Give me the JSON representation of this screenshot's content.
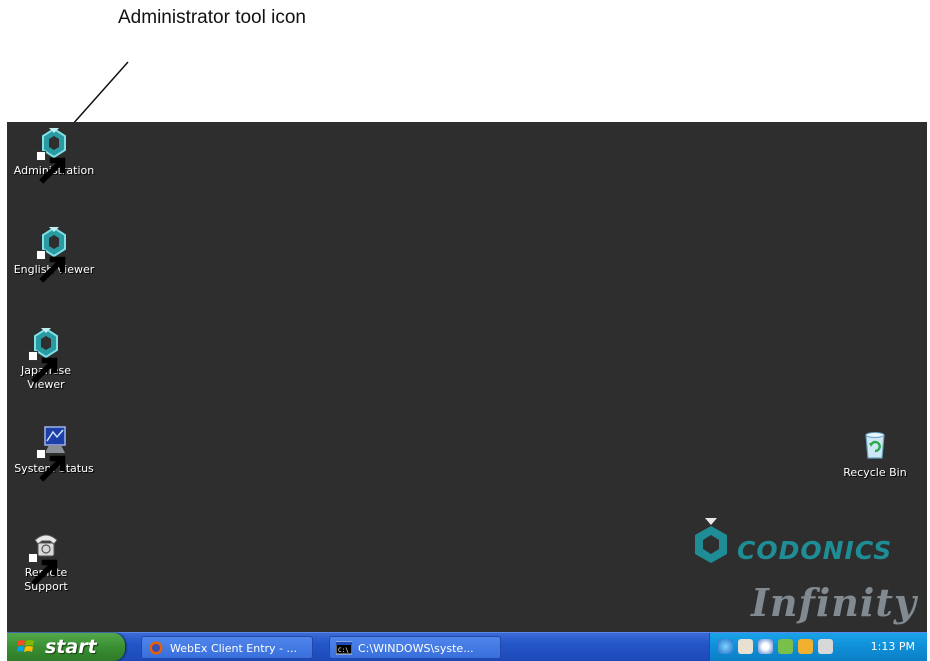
{
  "callout": {
    "text": "Administrator tool icon"
  },
  "desktop_icons": [
    {
      "label": "Administration",
      "icon": "codonics-icon"
    },
    {
      "label": "English Viewer",
      "icon": "codonics-icon"
    },
    {
      "label": "Japanese Viewer",
      "icon": "codonics-icon"
    },
    {
      "label": "System Status",
      "icon": "monitor-icon"
    },
    {
      "label": "Remote Support",
      "icon": "telephone-icon"
    },
    {
      "label": "Recycle Bin",
      "icon": "recycle-bin-icon"
    }
  ],
  "logo": {
    "brand": "CODONICS",
    "product": "Infinity"
  },
  "taskbar": {
    "start_label": "start",
    "tasks": [
      {
        "label": "WebEx Client Entry - ...",
        "icon": "firefox-icon"
      },
      {
        "label": "C:\\WINDOWS\\syste...",
        "icon": "command-prompt-icon"
      }
    ],
    "clock": "1:13 PM"
  },
  "colors": {
    "desktop": "#2e2e2e",
    "accent": "#1f8d95",
    "taskbar": "#2455c8",
    "start": "#3a8f33",
    "tray": "#0f8fd8"
  }
}
